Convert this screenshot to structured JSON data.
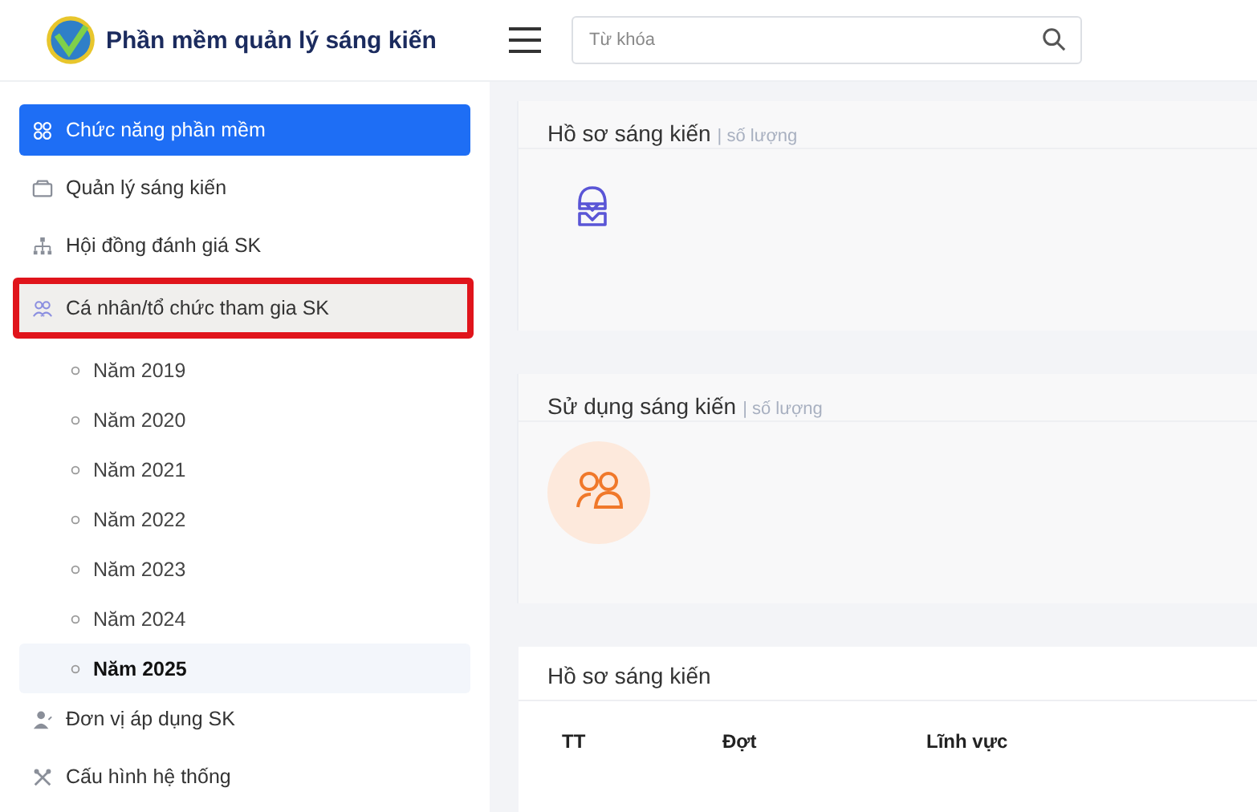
{
  "header": {
    "app_title": "Phần mềm quản lý sáng kiến",
    "search": {
      "placeholder": "Từ khóa"
    }
  },
  "sidebar": {
    "items": [
      {
        "label": "Chức năng phần mềm",
        "kind": "grid",
        "selected": true,
        "outlined": false
      },
      {
        "label": "Quản lý sáng kiến",
        "kind": "box",
        "selected": false,
        "outlined": false
      },
      {
        "label": "Hội đồng đánh giá SK",
        "kind": "org",
        "selected": false,
        "outlined": false
      },
      {
        "label": "Cá nhân/tổ chức tham gia SK",
        "kind": "people",
        "selected": false,
        "outlined": true,
        "expanded": true,
        "children": [
          {
            "label": "Năm 2019",
            "selected": false
          },
          {
            "label": "Năm 2020",
            "selected": false
          },
          {
            "label": "Năm 2021",
            "selected": false
          },
          {
            "label": "Năm 2022",
            "selected": false
          },
          {
            "label": "Năm 2023",
            "selected": false
          },
          {
            "label": "Năm 2024",
            "selected": false
          },
          {
            "label": "Năm 2025",
            "selected": true
          }
        ]
      },
      {
        "label": "Đơn vị áp dụng SK",
        "kind": "user",
        "selected": false,
        "outlined": false
      },
      {
        "label": "Cấu hình hệ thống",
        "kind": "tools",
        "selected": false,
        "outlined": false
      }
    ]
  },
  "cards": [
    {
      "title": "Hồ sơ sáng kiến",
      "subtitle": "| số lượng",
      "kind": "inbox"
    },
    {
      "title": "Sử dụng sáng kiến",
      "subtitle": "| số lượng",
      "kind": "people"
    }
  ],
  "table": {
    "title": "Hồ sơ sáng kiến",
    "columns": [
      "TT",
      "Đợt",
      "Lĩnh vực"
    ]
  }
}
